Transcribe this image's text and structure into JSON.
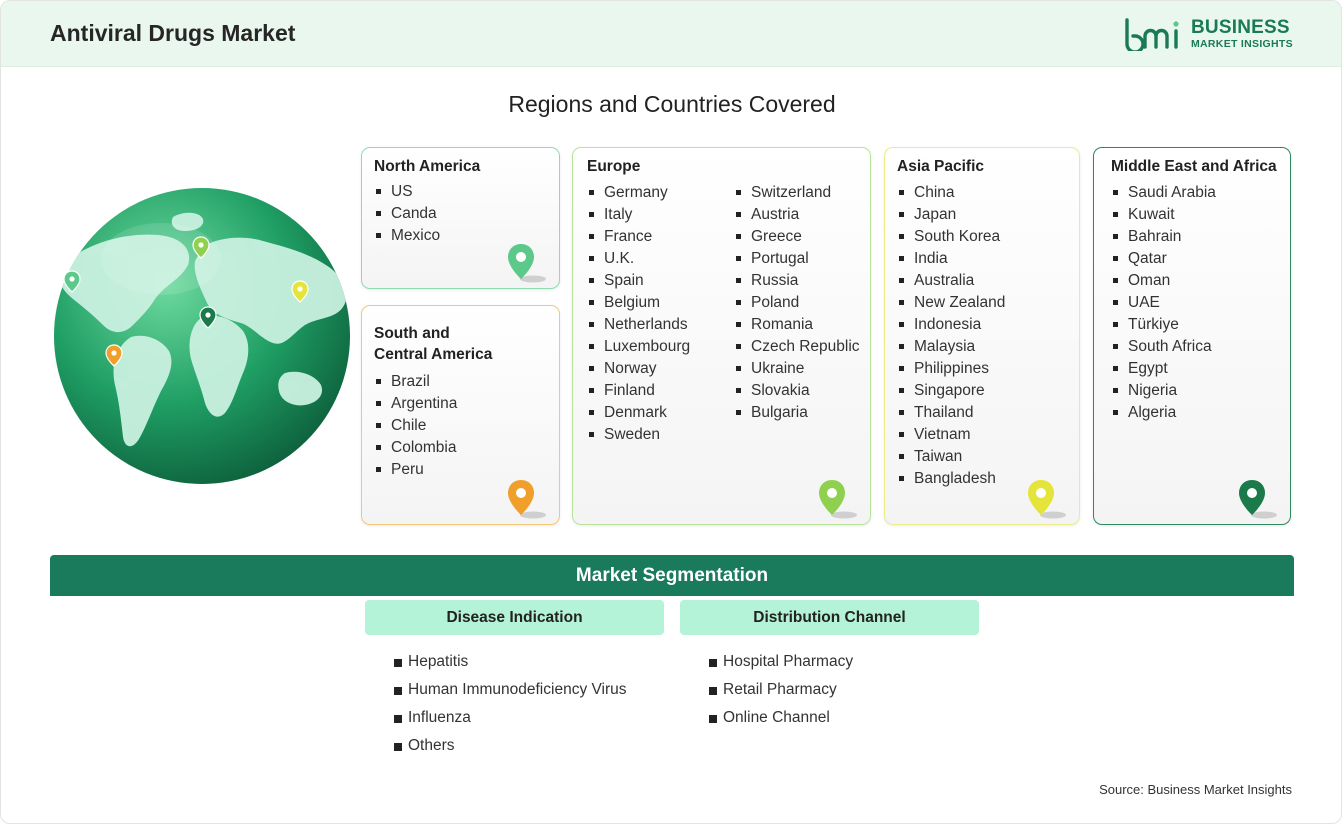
{
  "header": {
    "title": "Antiviral Drugs Market",
    "logo_line1": "BUSINESS",
    "logo_line2": "MARKET INSIGHTS",
    "logo_mark_text": "bmi"
  },
  "regions_title": "Regions and Countries Covered",
  "regions": {
    "north_america": {
      "title": "North America",
      "items": [
        "US",
        "Canda",
        "Mexico"
      ],
      "color": "#5cc98a"
    },
    "south_central_america": {
      "title_line1": "South and",
      "title_line2": "Central America",
      "items": [
        "Brazil",
        "Argentina",
        "Chile",
        "Colombia",
        "Peru"
      ],
      "color": "#f0a02a"
    },
    "europe": {
      "title": "Europe",
      "col1": [
        "Germany",
        "Italy",
        "France",
        "U.K.",
        "Spain",
        "Belgium",
        "Netherlands",
        "Luxembourg",
        "Norway",
        "Finland",
        "Denmark",
        "Sweden"
      ],
      "col2": [
        "Switzerland",
        "Austria",
        "Greece",
        "Portugal",
        "Russia",
        "Poland",
        "Romania",
        "Czech Republic",
        "Ukraine",
        "Slovakia",
        "Bulgaria"
      ],
      "color": "#8fd14f"
    },
    "asia_pacific": {
      "title": "Asia Pacific",
      "items": [
        "China",
        "Japan",
        "South Korea",
        "India",
        "Australia",
        "New Zealand",
        "Indonesia",
        "Malaysia",
        "Philippines",
        "Singapore",
        "Thailand",
        "Vietnam",
        "Taiwan",
        "Bangladesh"
      ],
      "color": "#e4e43a"
    },
    "middle_east_africa": {
      "title": "Middle East and Africa",
      "items": [
        "Saudi Arabia",
        "Kuwait",
        "Bahrain",
        "Qatar",
        "Oman",
        "UAE",
        "Türkiye",
        "South Africa",
        "Egypt",
        "Nigeria",
        "Algeria"
      ],
      "color": "#1a7a4a"
    }
  },
  "segmentation": {
    "title": "Market Segmentation",
    "disease": {
      "title": "Disease Indication",
      "items": [
        "Hepatitis",
        "Human Immunodeficiency Virus",
        "Influenza",
        "Others"
      ]
    },
    "distribution": {
      "title": "Distribution Channel",
      "items": [
        "Hospital Pharmacy",
        "Retail Pharmacy",
        "Online Channel"
      ]
    }
  },
  "source": "Source: Business Market Insights",
  "icons": [
    "globe-icon",
    "location-pin-icon",
    "bmi-logo-icon"
  ]
}
